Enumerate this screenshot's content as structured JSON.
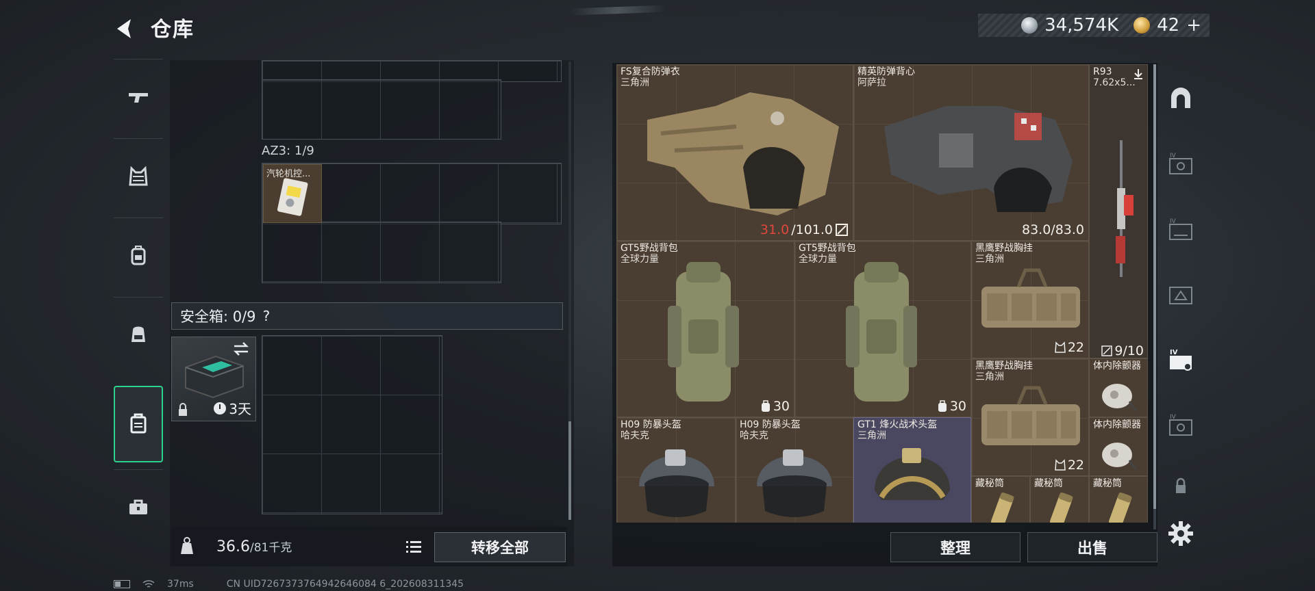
{
  "header": {
    "title": "仓库"
  },
  "currency": {
    "silver": "34,574K",
    "gold": "42",
    "add": "+"
  },
  "left_nav": {
    "items": [
      "gun",
      "armor",
      "backpack",
      "chest-rig",
      "safe-box",
      "toolbox"
    ],
    "active": "safe-box"
  },
  "az3": {
    "label": "AZ3: 1/9",
    "item": {
      "label": "汽轮机控..."
    }
  },
  "safe_box": {
    "label": "安全箱: 0/9",
    "help": "?",
    "days": "3天"
  },
  "weight": {
    "current": "36.6",
    "max": "/81千克"
  },
  "buttons": {
    "transfer_all": "转移全部",
    "sort": "整理",
    "sell": "出售"
  },
  "stash_items": [
    {
      "name": "FS复合防弹衣",
      "sub": "三角洲",
      "dur": "31.0",
      "dur_max": "/101.0"
    },
    {
      "name": "精英防弹背心",
      "sub": "阿萨拉",
      "dur": "83.0/83.0"
    },
    {
      "name": "R93",
      "sub": "7.62x5..."
    },
    {
      "name": "GT5野战背包",
      "sub": "全球力量",
      "count": "30"
    },
    {
      "name": "GT5野战背包",
      "sub": "全球力量",
      "count": "30"
    },
    {
      "name": "黑鹰野战胸挂",
      "sub": "三角洲",
      "count": "22"
    },
    {
      "name": "",
      "sub": "",
      "count": "9/10"
    },
    {
      "name": "黑鹰野战胸挂",
      "sub": "三角洲",
      "count": "22"
    },
    {
      "name": "体内除颤器",
      "sub": ""
    },
    {
      "name": "体内除颤器",
      "sub": ""
    },
    {
      "name": "H09 防暴头盔",
      "sub": "哈夫克"
    },
    {
      "name": "H09 防暴头盔",
      "sub": "哈夫克"
    },
    {
      "name": "GT1 烽火战术头盔",
      "sub": "三角洲"
    },
    {
      "name": "藏秘筒",
      "sub": ""
    },
    {
      "name": "藏秘筒",
      "sub": ""
    },
    {
      "name": "藏秘筒",
      "sub": ""
    }
  ],
  "status_bar": {
    "ping": "37ms",
    "uid": "CN UID7267373764942646084 6_202608311345"
  },
  "colors": {
    "accent": "#2bd48e",
    "durability_low": "#e2473d"
  }
}
